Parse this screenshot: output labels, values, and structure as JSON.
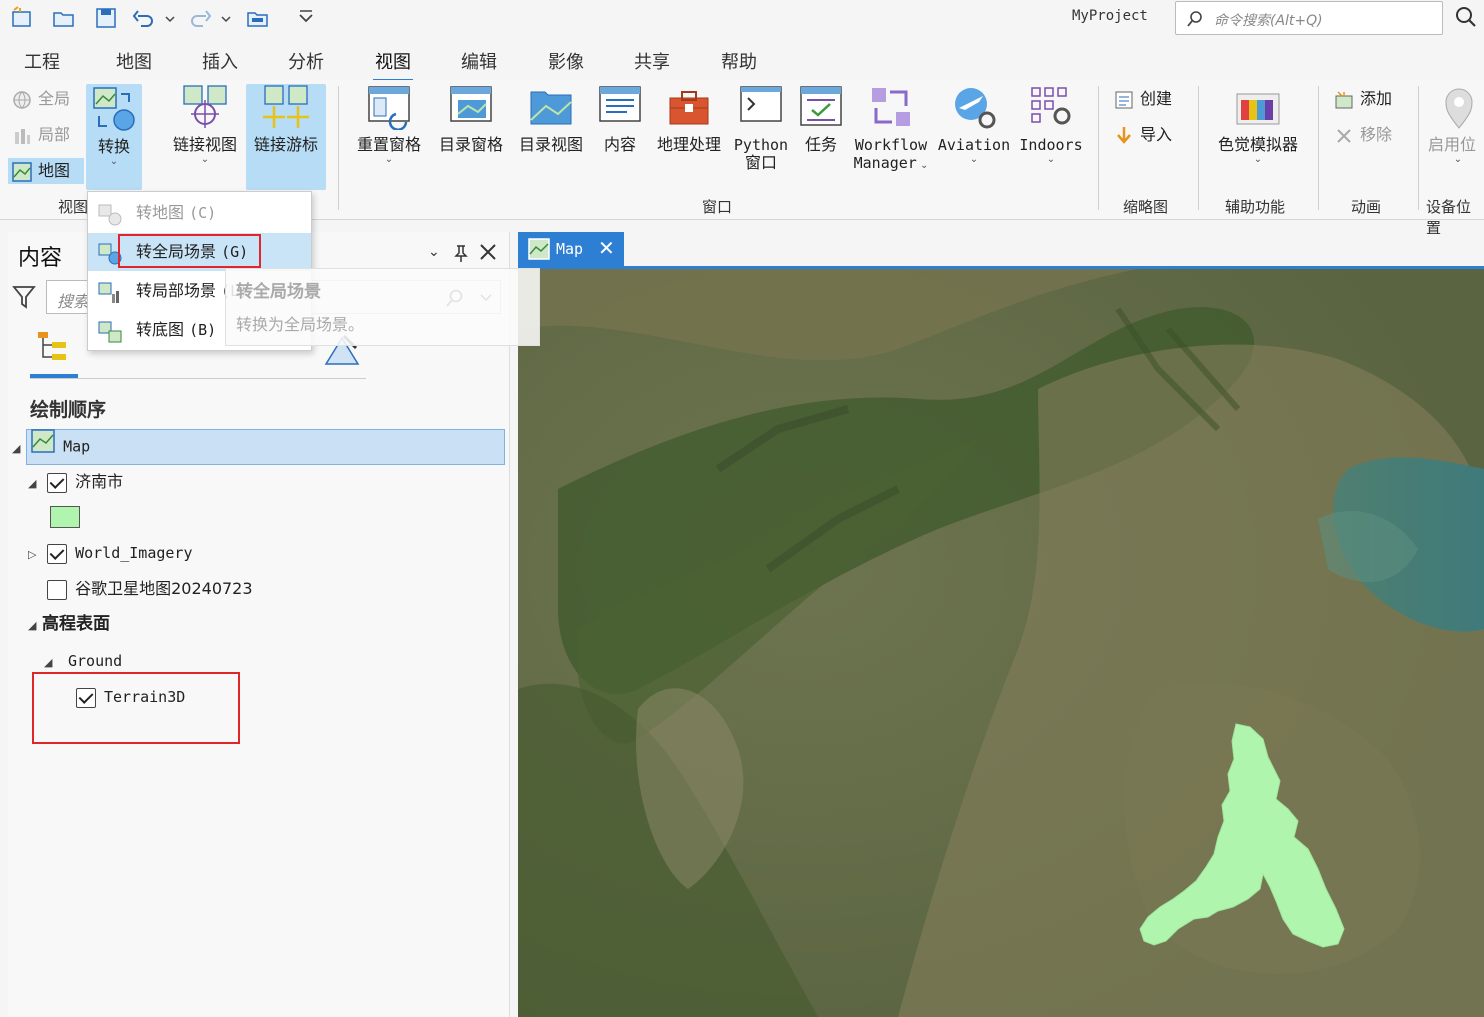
{
  "app": {
    "project_name": "MyProject",
    "command_search_placeholder": "命令搜索(Alt+Q)"
  },
  "tabs": [
    "工程",
    "地图",
    "插入",
    "分析",
    "视图",
    "编辑",
    "影像",
    "共享",
    "帮助"
  ],
  "active_tab": "视图",
  "ribbon": {
    "view_group": {
      "label": "视图",
      "global": "全局",
      "local": "局部",
      "map": "地图",
      "convert": "转换",
      "link_views": "链接视图",
      "link_cursor": "链接游标"
    },
    "window_group": {
      "label": "窗口",
      "reset_panes": "重置窗格",
      "catalog_pane": "目录窗格",
      "catalog_view": "目录视图",
      "contents": "内容",
      "geoprocessing": "地理处理",
      "python_l1": "Python",
      "python_l2": "窗口",
      "tasks": "任务",
      "workflow_l1": "Workflow",
      "workflow_l2": "Manager",
      "aviation": "Aviation",
      "indoors": "Indoors"
    },
    "thumbnail_group": {
      "label": "缩略图",
      "create": "创建",
      "import": "导入"
    },
    "accessibility_group": {
      "label": "辅助功能",
      "color_sim": "色觉模拟器"
    },
    "animation_group": {
      "label": "动画",
      "add": "添加",
      "remove": "移除"
    },
    "device_group": {
      "label": "设备位置",
      "enable": "启用位"
    }
  },
  "dropdown": {
    "items": [
      {
        "label": "转地图",
        "key": "(C)"
      },
      {
        "label": "转全局场景",
        "key": "(G)"
      },
      {
        "label": "转局部场景",
        "key": "(L)"
      },
      {
        "label": "转底图",
        "key": "(B)"
      }
    ],
    "tooltip_title": "转全局场景",
    "tooltip_desc": "转换为全局场景。"
  },
  "contents_pane": {
    "title": "内容",
    "search_placeholder": "搜索",
    "section": "绘制顺序",
    "map": "Map",
    "layers": [
      {
        "name": "济南市",
        "checked": true
      },
      {
        "name": "World_Imagery",
        "checked": true
      },
      {
        "name": "谷歌卫星地图20240723",
        "checked": false
      }
    ],
    "elevation": "高程表面",
    "ground": "Ground",
    "terrain": "Terrain3D",
    "symbol_color": "#b0f5ad"
  },
  "map_view": {
    "tab": "Map"
  },
  "colors": {
    "accent": "#2d7fd3",
    "selection": "#c9e0f5",
    "highlight_box": "#e0262a",
    "polygon": "#b0f5ad"
  }
}
